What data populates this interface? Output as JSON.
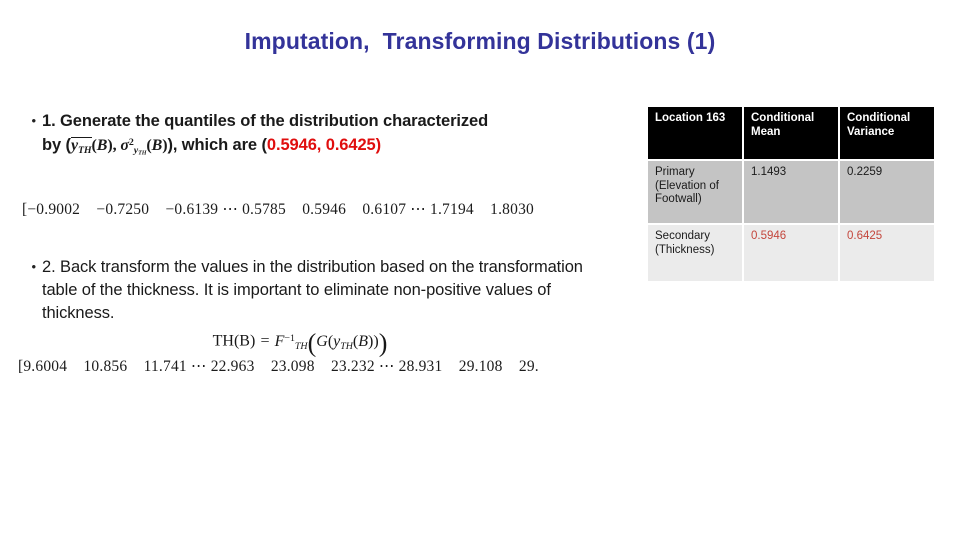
{
  "slide": {
    "title": "Imputation,  Transforming Distributions (1)",
    "title_color": "#333399",
    "background": "#ffffff"
  },
  "bullets": [
    {
      "marker": "•",
      "number": "1.",
      "line1": "1. Generate the quantiles of the distribution characterized",
      "line2_prefix": "by (",
      "math_mean_var": "y̅TH(B), σ²yTH(B)",
      "line2_middle": "), which are (",
      "value_mean": "0.5946",
      "value_separator": ",  ",
      "value_variance": "0.6425",
      "line2_suffix": ")",
      "value_color": "#e00e0e"
    },
    {
      "marker": "•",
      "number": "2.",
      "text": "2. Back transform the values in the distribution based on the transformation table of the thickness. It is important to eliminate non-positive values of thickness."
    }
  ],
  "vectors": {
    "quantiles": {
      "label": "quantiles-vector",
      "text": "[−0.9002    −0.7250    −0.6139 ⋯ 0.5785    0.5946    0.6107 ⋯ 1.7194    1.8030",
      "values_shown": [
        "-0.9002",
        "-0.7250",
        "-0.6139",
        "0.5785",
        "0.5946",
        "0.6107",
        "1.7194",
        "1.8030"
      ]
    },
    "backtransformed": {
      "label": "backtransformed-vector",
      "text": "[9.6004    10.856    11.741 ⋯ 22.963    23.098    23.232 ⋯ 28.931    29.108    29.",
      "values_shown": [
        "9.6004",
        "10.856",
        "11.741",
        "22.963",
        "23.098",
        "23.232",
        "28.931",
        "29.108",
        "29."
      ]
    }
  },
  "equation": {
    "lhs": "TH(B)",
    "equals": "=",
    "rhs_function": "F",
    "rhs_subscript": "TH",
    "rhs_superscript": "−1",
    "inner": "G(yTH(B))"
  },
  "table": {
    "headers": [
      "Location 163",
      "Conditional Mean",
      "Conditional Variance"
    ],
    "header_lines": [
      [
        "Location 163"
      ],
      [
        "Conditional",
        "Mean"
      ],
      [
        "Conditional",
        "Variance"
      ]
    ],
    "header_bg": "#000000",
    "header_fg": "#ffffff",
    "rows": [
      {
        "label_lines": [
          "Primary",
          "(Elevation of",
          "Footwall)"
        ],
        "conditional_mean": "1.1493",
        "conditional_variance": "0.2259",
        "bg": "#c4c4c4",
        "value_color": "#1a1a1a"
      },
      {
        "label_lines": [
          "Secondary",
          "(Thickness)"
        ],
        "conditional_mean": "0.5946",
        "conditional_variance": "0.6425",
        "bg": "#ebebeb",
        "value_color": "#c4463c"
      }
    ]
  }
}
